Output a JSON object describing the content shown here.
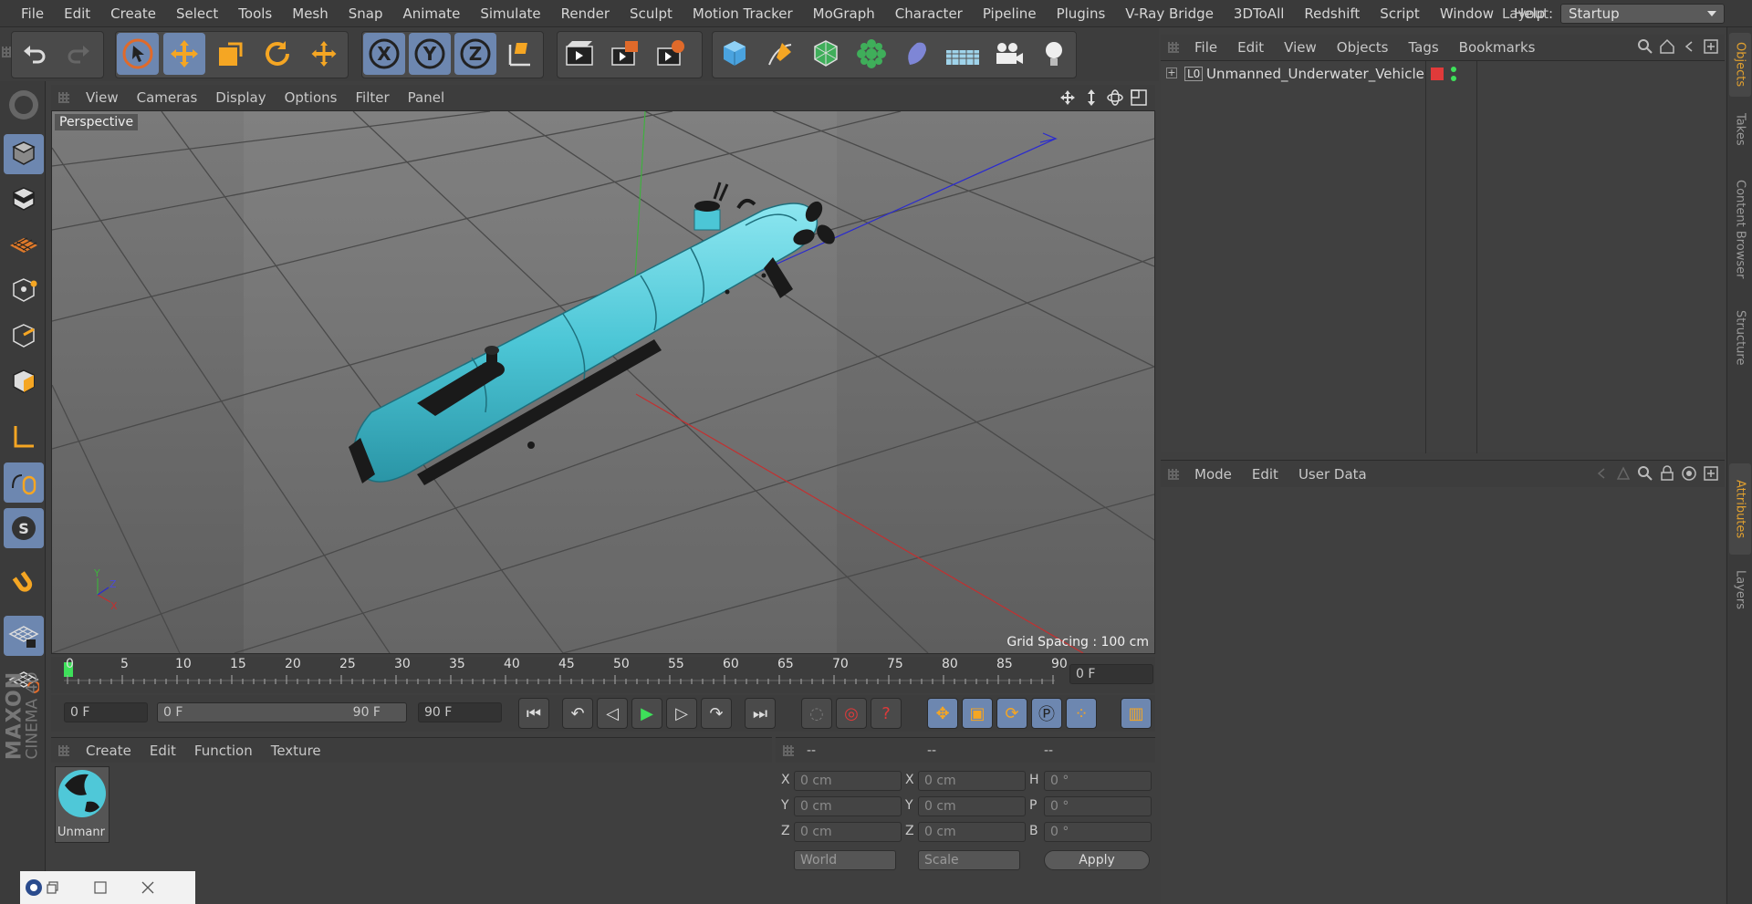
{
  "menubar": {
    "items": [
      "File",
      "Edit",
      "Create",
      "Select",
      "Tools",
      "Mesh",
      "Snap",
      "Animate",
      "Simulate",
      "Render",
      "Sculpt",
      "Motion Tracker",
      "MoGraph",
      "Character",
      "Pipeline",
      "Plugins",
      "V-Ray Bridge",
      "3DToAll",
      "Redshift",
      "Script",
      "Window",
      "Help"
    ],
    "layout_label": "Layout:",
    "layout_value": "Startup"
  },
  "toolbar": {
    "axis_x": "X",
    "axis_y": "Y",
    "axis_z": "Z"
  },
  "viewport": {
    "menu": [
      "View",
      "Cameras",
      "Display",
      "Options",
      "Filter",
      "Panel"
    ],
    "camera_label": "Perspective",
    "grid_spacing": "Grid Spacing : 100 cm",
    "axis_y": "Y",
    "axis_z": "Z",
    "axis_x": "X"
  },
  "timeline": {
    "ticks": [
      "0",
      "5",
      "10",
      "15",
      "20",
      "25",
      "30",
      "35",
      "40",
      "45",
      "50",
      "55",
      "60",
      "65",
      "70",
      "75",
      "80",
      "85",
      "90"
    ],
    "current_frame": "0 F",
    "start_frame": "0 F",
    "range_start": "0 F",
    "range_end": "90 F",
    "end_frame": "90 F"
  },
  "materials": {
    "menu": [
      "Create",
      "Edit",
      "Function",
      "Texture"
    ],
    "items": [
      {
        "label": "Unmanr"
      }
    ]
  },
  "coordinates": {
    "headers": [
      "--",
      "--",
      "--"
    ],
    "rows": [
      {
        "l1": "X",
        "v1": "0 cm",
        "l2": "X",
        "v2": "0 cm",
        "l3": "H",
        "v3": "0 °"
      },
      {
        "l1": "Y",
        "v1": "0 cm",
        "l2": "Y",
        "v2": "0 cm",
        "l3": "P",
        "v3": "0 °"
      },
      {
        "l1": "Z",
        "v1": "0 cm",
        "l2": "Z",
        "v2": "0 cm",
        "l3": "B",
        "v3": "0 °"
      }
    ],
    "mode_world": "World",
    "mode_scale": "Scale",
    "apply": "Apply"
  },
  "objects": {
    "menu": [
      "File",
      "Edit",
      "View",
      "Objects",
      "Tags",
      "Bookmarks"
    ],
    "items": [
      {
        "name": "Unmanned_Underwater_Vehicle",
        "layer_badge": "L0"
      }
    ]
  },
  "attributes": {
    "menu": [
      "Mode",
      "Edit",
      "User Data"
    ]
  },
  "side_tabs": [
    "Objects",
    "Takes",
    "Content Browser",
    "Structure",
    "Attributes",
    "Layers"
  ],
  "brand": {
    "line1": "MAXON",
    "line2": "CINEMA 4D"
  },
  "colors": {
    "accent": "#6d87b0",
    "model": "#4fc8d8",
    "active_tab": "#e0a030"
  }
}
